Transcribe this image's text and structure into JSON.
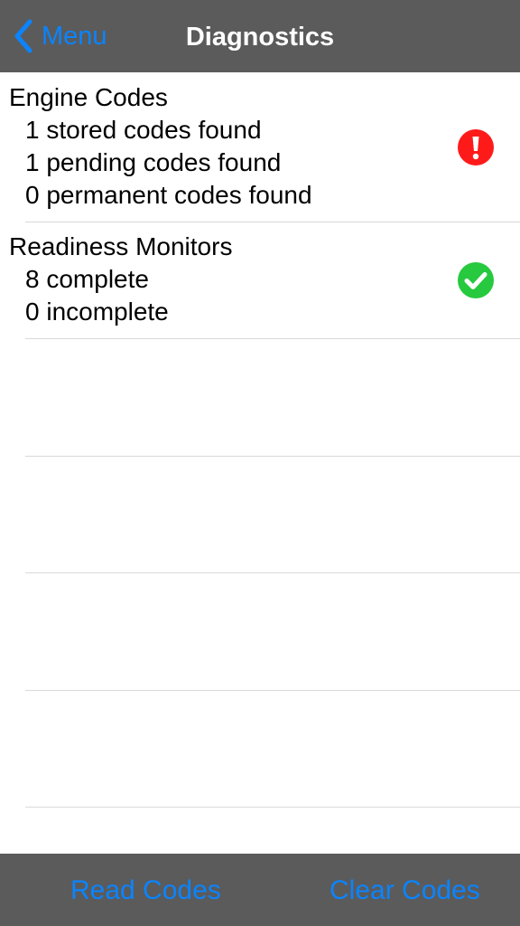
{
  "colors": {
    "bar_background": "#5b5b5b",
    "accent": "#0a84ff",
    "warning": "#ff1a1a",
    "success": "#27c93f"
  },
  "navbar": {
    "back_label": "Menu",
    "back_icon": "chevron-left-icon",
    "title": "Diagnostics"
  },
  "engine_codes": {
    "title": "Engine Codes",
    "lines": [
      "1 stored codes found",
      "1 pending codes found",
      "0 permanent codes found"
    ],
    "status_icon": "exclamation-circle-icon"
  },
  "readiness_monitors": {
    "title": "Readiness Monitors",
    "lines": [
      "8 complete",
      "0 incomplete"
    ],
    "status_icon": "checkmark-circle-icon"
  },
  "toolbar": {
    "read_codes_label": "Read Codes",
    "clear_codes_label": "Clear Codes"
  }
}
